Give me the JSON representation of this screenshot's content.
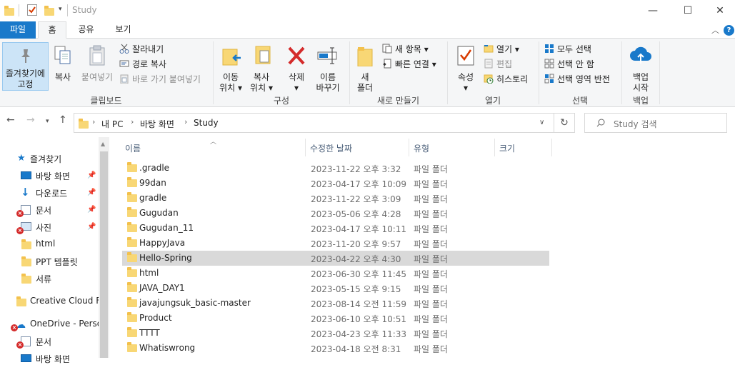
{
  "window": {
    "title": "Study",
    "minimize_glyph": "—",
    "maximize_glyph": "☐",
    "close_glyph": "✕"
  },
  "ribbon_tabs": [
    "파일",
    "홈",
    "공유",
    "보기"
  ],
  "ribbon": {
    "clipboard": {
      "pin_label_1": "즐겨찾기에",
      "pin_label_2": "고정",
      "copy": "복사",
      "paste": "붙여넣기",
      "cut": "잘라내기",
      "copy_path": "경로 복사",
      "paste_shortcut": "바로 가기 붙여넣기",
      "group": "클립보드"
    },
    "organize": {
      "move_1": "이동",
      "move_2": "위치",
      "copy_1": "복사",
      "copy_2": "위치",
      "delete": "삭제",
      "rename_1": "이름",
      "rename_2": "바꾸기",
      "group": "구성"
    },
    "new": {
      "new_folder_1": "새",
      "new_folder_2": "폴더",
      "new_item": "새 항목",
      "easy_access": "빠른 연결",
      "group": "새로 만들기"
    },
    "open": {
      "properties": "속성",
      "open": "열기",
      "edit": "편집",
      "history": "히스토리",
      "group": "열기"
    },
    "select": {
      "select_all": "모두 선택",
      "select_none": "선택 안 함",
      "invert": "선택 영역 반전",
      "group": "선택"
    },
    "backup": {
      "start_1": "백업",
      "start_2": "시작",
      "group": "백업"
    }
  },
  "address": {
    "crumbs": [
      "내 PC",
      "바탕 화면",
      "Study"
    ],
    "search_placeholder": "Study 검색"
  },
  "nav": {
    "quick_access": "즐겨찾기",
    "items": [
      {
        "label": "바탕 화면",
        "pinned": true,
        "error": false
      },
      {
        "label": "다운로드",
        "pinned": true,
        "error": false
      },
      {
        "label": "문서",
        "pinned": true,
        "error": true
      },
      {
        "label": "사진",
        "pinned": true,
        "error": true
      },
      {
        "label": "html",
        "pinned": false,
        "error": false
      },
      {
        "label": "PPT 템플릿",
        "pinned": false,
        "error": false
      },
      {
        "label": "서류",
        "pinned": false,
        "error": false
      }
    ],
    "creative_cloud": "Creative Cloud Fil",
    "onedrive": "OneDrive - Persor",
    "onedrive_docs": "문서",
    "onedrive_desktop": "바탕 화면"
  },
  "columns": {
    "name": "이름",
    "date": "수정한 날짜",
    "type": "유형",
    "size": "크기"
  },
  "files": [
    {
      "name": ".gradle",
      "date": "2023-11-22 오후 3:32",
      "type": "파일 폴더"
    },
    {
      "name": "99dan",
      "date": "2023-04-17 오후 10:09",
      "type": "파일 폴더"
    },
    {
      "name": "gradle",
      "date": "2023-11-22 오후 3:09",
      "type": "파일 폴더"
    },
    {
      "name": "Gugudan",
      "date": "2023-05-06 오후 4:28",
      "type": "파일 폴더"
    },
    {
      "name": "Gugudan_11",
      "date": "2023-04-17 오후 10:11",
      "type": "파일 폴더"
    },
    {
      "name": "HappyJava",
      "date": "2023-11-20 오후 9:57",
      "type": "파일 폴더"
    },
    {
      "name": "Hello-Spring",
      "date": "2023-04-22 오후 4:30",
      "type": "파일 폴더"
    },
    {
      "name": "html",
      "date": "2023-06-30 오후 11:45",
      "type": "파일 폴더"
    },
    {
      "name": "JAVA_DAY1",
      "date": "2023-05-15 오후 9:15",
      "type": "파일 폴더"
    },
    {
      "name": "javajungsuk_basic-master",
      "date": "2023-08-14 오전 11:59",
      "type": "파일 폴더"
    },
    {
      "name": "Product",
      "date": "2023-06-10 오후 10:51",
      "type": "파일 폴더"
    },
    {
      "name": "TTTT",
      "date": "2023-04-23 오후 11:33",
      "type": "파일 폴더"
    },
    {
      "name": "Whatiswrong",
      "date": "2023-04-18 오전 8:31",
      "type": "파일 폴더"
    }
  ],
  "selected_file": "Hello-Spring",
  "colors": {
    "accent": "#1979ca",
    "folder": "#f8d775",
    "selection": "#d9d9d9"
  }
}
